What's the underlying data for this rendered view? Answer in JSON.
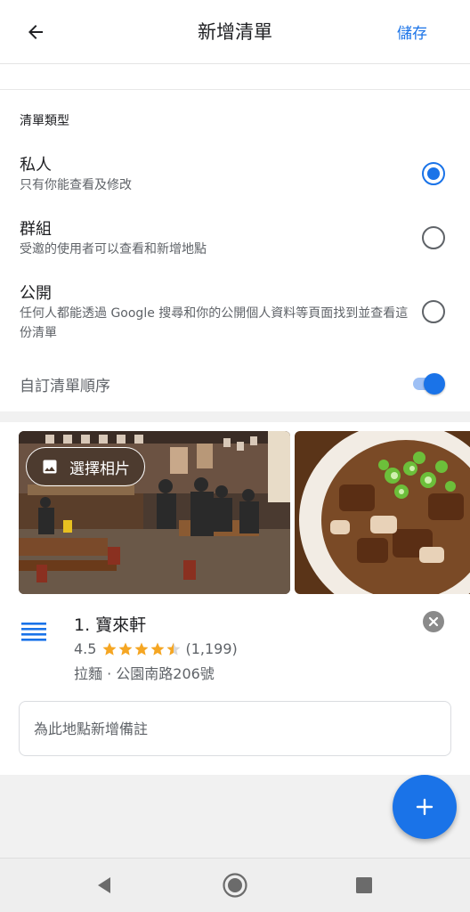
{
  "appbar": {
    "title": "新增清單",
    "save_label": "儲存"
  },
  "list_type": {
    "section_label": "清單類型",
    "options": [
      {
        "title": "私人",
        "desc": "只有你能查看及修改",
        "selected": true
      },
      {
        "title": "群組",
        "desc": "受邀的使用者可以查看和新增地點",
        "selected": false
      },
      {
        "title": "公開",
        "desc": "任何人都能透過 Google 搜尋和你的公開個人資料等頁面找到並查看這份清單",
        "selected": false
      }
    ],
    "custom_order_label": "自訂清單順序",
    "custom_order_enabled": true
  },
  "place": {
    "choose_photo_label": "選擇相片",
    "name": "1. 寶來軒",
    "rating": "4.5",
    "stars": 4.5,
    "reviews": "(1,199)",
    "subtitle": "拉麵 · 公園南路206號",
    "note_placeholder": "為此地點新增備註"
  },
  "colors": {
    "accent": "#1a73e8",
    "star": "#f5a623"
  },
  "icons": [
    "back-arrow-icon",
    "image-icon",
    "drag-handle-icon",
    "close-icon",
    "plus-icon",
    "nav-back-icon",
    "nav-home-icon",
    "nav-recents-icon"
  ]
}
